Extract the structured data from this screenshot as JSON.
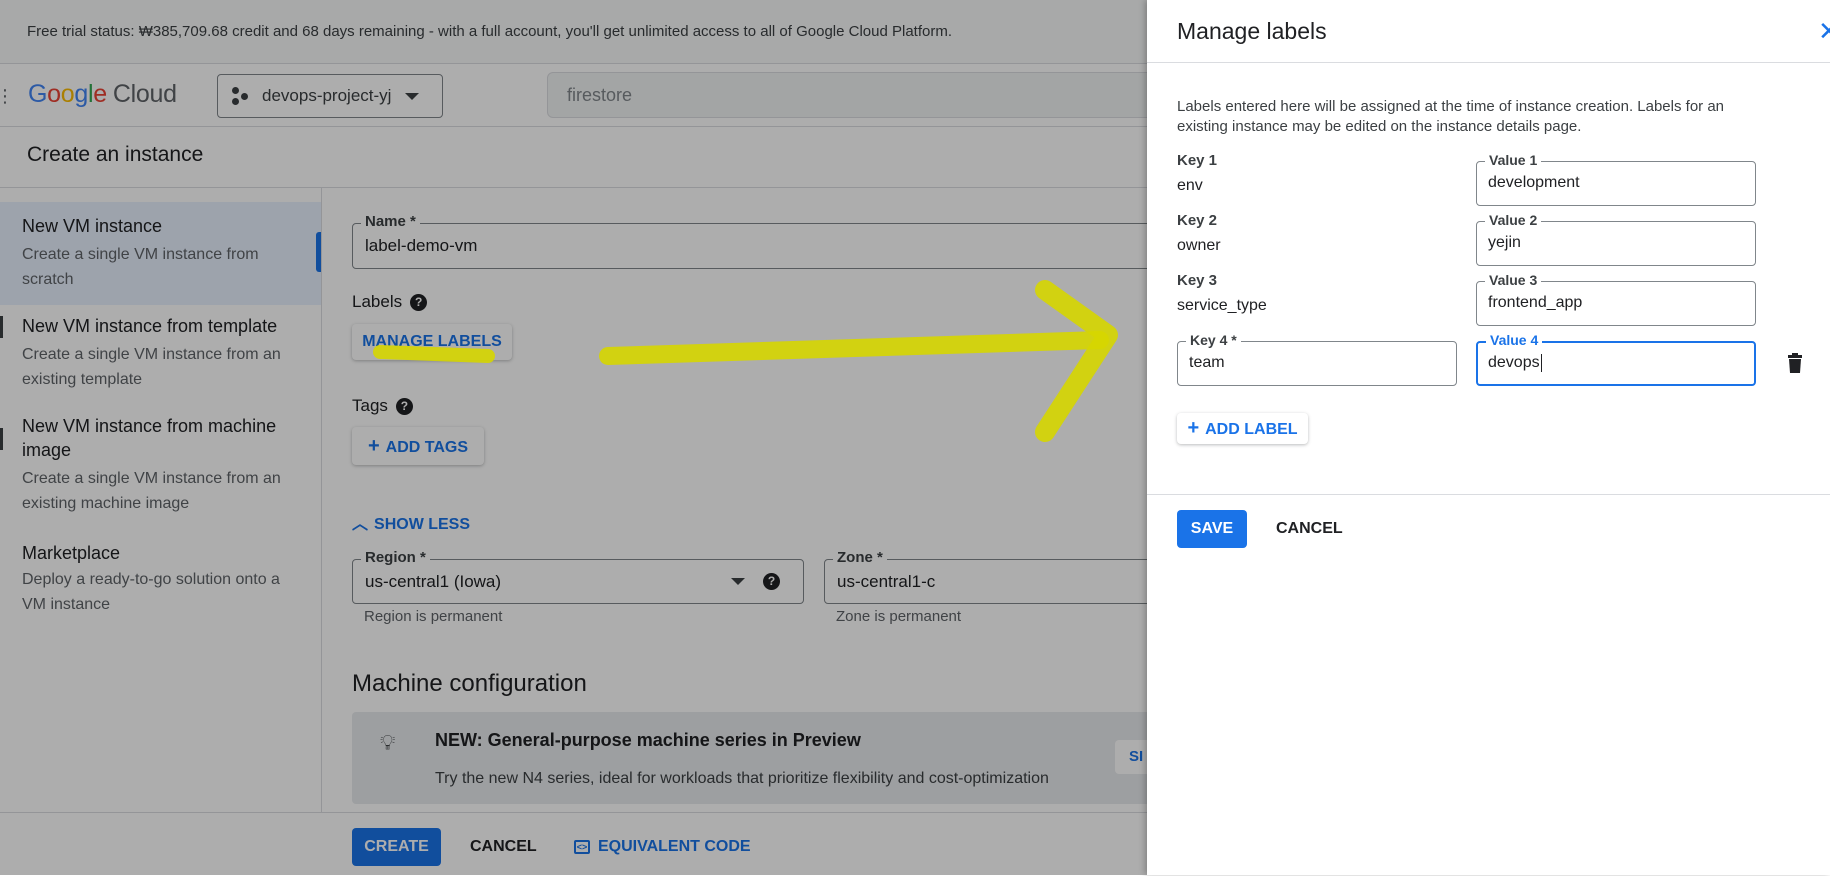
{
  "trial_banner": "Free trial status: ₩385,709.68 credit and 68 days remaining - with a full account, you'll get unlimited access to all of Google Cloud Platform.",
  "header": {
    "logo_letters": [
      "G",
      "o",
      "o",
      "g",
      "l",
      "e"
    ],
    "logo_product": "Cloud",
    "project": "devops-project-yj",
    "search_value": "firestore"
  },
  "page_title": "Create an instance",
  "nav": {
    "items": [
      {
        "title": "New VM instance",
        "desc": "Create a single VM instance from scratch"
      },
      {
        "title": "New VM instance from template",
        "desc": "Create a single VM instance from an existing template"
      },
      {
        "title": "New VM instance from machine image",
        "desc": "Create a single VM instance from an existing machine image"
      },
      {
        "title": "Marketplace",
        "desc": "Deploy a ready-to-go solution onto a VM instance"
      }
    ]
  },
  "form": {
    "name_label": "Name *",
    "name_value": "label-demo-vm",
    "labels_heading": "Labels",
    "manage_labels": "MANAGE LABELS",
    "tags_heading": "Tags",
    "add_tags": "ADD TAGS",
    "show_less": "SHOW LESS",
    "region_label": "Region *",
    "region_value": "us-central1 (Iowa)",
    "region_hint": "Region is permanent",
    "zone_label": "Zone *",
    "zone_value": "us-central1-c",
    "zone_hint": "Zone is permanent",
    "machine_heading": "Machine configuration",
    "banner_title": "NEW: General-purpose machine series in Preview",
    "banner_text": "Try the new N4 series, ideal for workloads that prioritize flexibility and cost-optimization",
    "banner_link": "SI"
  },
  "footer": {
    "create": "CREATE",
    "cancel": "CANCEL",
    "equivalent_code": "EQUIVALENT CODE"
  },
  "panel": {
    "title": "Manage labels",
    "description": "Labels entered here will be assigned at the time of instance creation. Labels for an existing instance may be edited on the instance details page.",
    "labels": [
      {
        "key_label": "Key 1",
        "key": "env",
        "value_label": "Value 1",
        "value": "development"
      },
      {
        "key_label": "Key 2",
        "key": "owner",
        "value_label": "Value 2",
        "value": "yejin"
      },
      {
        "key_label": "Key 3",
        "key": "service_type",
        "value_label": "Value 3",
        "value": "frontend_app"
      },
      {
        "key_label": "Key 4 *",
        "key": "team",
        "value_label": "Value 4",
        "value": "devops"
      }
    ],
    "add_label": "ADD LABEL",
    "save": "SAVE",
    "cancel": "CANCEL"
  },
  "colors": {
    "accent": "#1a73e8",
    "annotation": "#e6e600",
    "scrim": "rgba(0,0,0,0.32)"
  }
}
